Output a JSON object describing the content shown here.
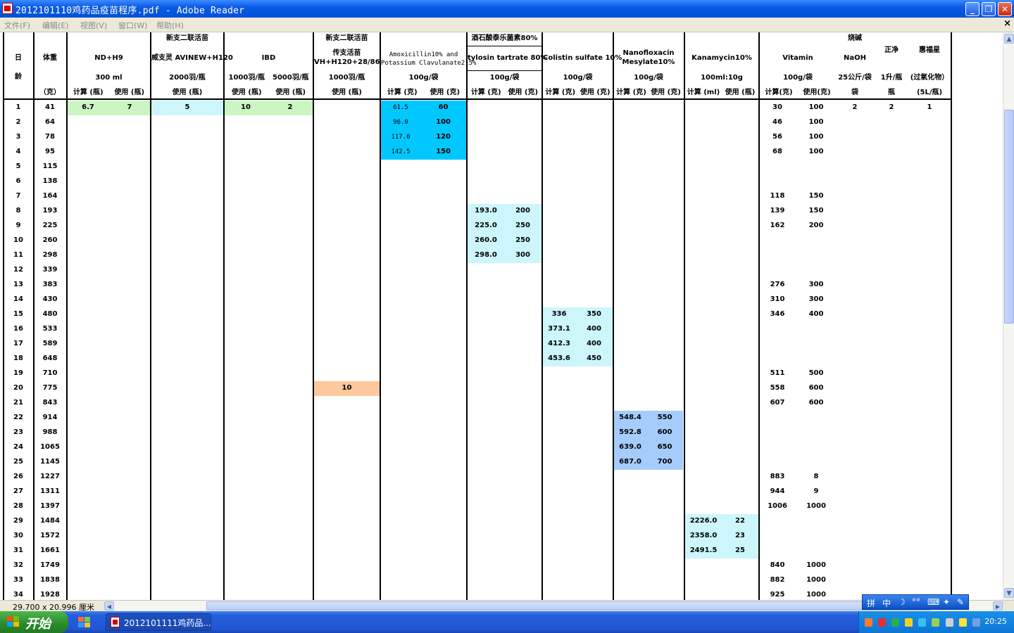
{
  "window": {
    "title": "2012101110鸡药品疫苗程序.pdf - Adobe Reader",
    "minimize": "_",
    "restore": "❐",
    "close": "✕"
  },
  "menu": {
    "items": [
      "文件(F)",
      "编辑(E)",
      "视图(V)",
      "窗口(W)",
      "帮助(H)"
    ],
    "doc_close": "×"
  },
  "table": {
    "header_day": [
      "日",
      "龄"
    ],
    "header_weight": [
      "体重",
      "（克）"
    ],
    "col_groups": [
      {
        "top": "",
        "name": "ND+H9",
        "unit": "300 ml",
        "subs": [
          "计算 (瓶)",
          "使用 (瓶)"
        ]
      },
      {
        "top": "新支二联活苗",
        "name": "威支灵 AVINEW+H120",
        "unit": "2000羽/瓶",
        "subs": [
          "使用 (瓶)"
        ]
      },
      {
        "top": "",
        "name": "IBD",
        "unit": "",
        "subs": [
          "1000羽/瓶",
          "5000羽/瓶"
        ],
        "subs2": [
          "使用 (瓶)",
          "使用 (瓶)"
        ]
      },
      {
        "top": "新支二联活苗",
        "name": "传支活苗 VH+H120+28/86",
        "unit": "1000羽/瓶",
        "subs": [
          "使用 (瓶)"
        ]
      },
      {
        "top": "",
        "name": "Amoxicillin10% and Potassium Clavulanate2.5%",
        "unit": "100g/袋",
        "subs": [
          "计算 (克)",
          "使用 (克)"
        ]
      },
      {
        "top": "酒石酸泰乐菌素80%",
        "name": "tylosin tartrate 80%",
        "unit": "100g/袋",
        "subs": [
          "计算 (克)",
          "使用 (克)"
        ]
      },
      {
        "top": "",
        "name": "Colistin sulfate 10%",
        "unit": "100g/袋",
        "subs": [
          "计算 (克)",
          "使用 (克)"
        ]
      },
      {
        "top": "",
        "name": "Nanofloxacin Mesylate10%",
        "unit": "100g/袋",
        "subs": [
          "计算 (克)",
          "使用 (克)"
        ]
      },
      {
        "top": "",
        "name": "Kanamycin10%",
        "unit": "100ml:10g",
        "subs": [
          "计算 (ml)",
          "使用 (瓶)"
        ]
      },
      {
        "top": "",
        "name": "Vitamin",
        "unit": "100g/袋",
        "subs": [
          "计算(克)",
          "使用(克)"
        ]
      },
      {
        "top": "烧碱",
        "name": "NaOH",
        "unit": "25公斤/袋",
        "subs": [
          "袋"
        ]
      },
      {
        "top": "",
        "name": "正净",
        "unit": "1升/瓶",
        "subs": [
          "瓶"
        ]
      },
      {
        "top": "",
        "name": "惠福星",
        "unit": "(过氧化物）",
        "subs": [
          "(5L/瓶)"
        ]
      }
    ],
    "days": [
      "1",
      "2",
      "3",
      "4",
      "5",
      "6",
      "7",
      "8",
      "9",
      "10",
      "11",
      "12",
      "13",
      "14",
      "15",
      "16",
      "17",
      "18",
      "19",
      "20",
      "21",
      "22",
      "23",
      "24",
      "25",
      "26",
      "27",
      "28",
      "29",
      "30",
      "31",
      "32",
      "33",
      "34"
    ],
    "weights": [
      "41",
      "64",
      "78",
      "95",
      "115",
      "138",
      "164",
      "193",
      "225",
      "260",
      "298",
      "339",
      "383",
      "430",
      "480",
      "533",
      "589",
      "648",
      "710",
      "775",
      "843",
      "914",
      "988",
      "1065",
      "1145",
      "1227",
      "1311",
      "1397",
      "1484",
      "1572",
      "1661",
      "1749",
      "1838",
      "1928"
    ],
    "nd_h9": {
      "calc": "6.7",
      "use": "7"
    },
    "avinew": "5",
    "ibd": {
      "a": "10",
      "b": "2"
    },
    "vh": "10",
    "amox": {
      "calc": [
        "61.5",
        "96.0",
        "117.0",
        "142.5"
      ],
      "use": [
        "60",
        "100",
        "120",
        "150"
      ]
    },
    "tylosin": {
      "calc": [
        "193.0",
        "225.0",
        "260.0",
        "298.0"
      ],
      "use": [
        "200",
        "250",
        "250",
        "300"
      ]
    },
    "colistin": {
      "calc": [
        "336",
        "373.1",
        "412.3",
        "453.6"
      ],
      "use": [
        "350",
        "400",
        "400",
        "450"
      ]
    },
    "nano": {
      "calc": [
        "548.4",
        "592.8",
        "639.0",
        "687.0"
      ],
      "use": [
        "550",
        "600",
        "650",
        "700"
      ]
    },
    "kana": {
      "calc": [
        "2226.0",
        "2358.0",
        "2491.5"
      ],
      "use": [
        "22",
        "23",
        "25"
      ]
    },
    "vitamin": [
      {
        "day": 1,
        "calc": "30",
        "use": "100"
      },
      {
        "day": 2,
        "calc": "46",
        "use": "100"
      },
      {
        "day": 3,
        "calc": "56",
        "use": "100"
      },
      {
        "day": 4,
        "calc": "68",
        "use": "100"
      },
      {
        "day": 7,
        "calc": "118",
        "use": "150"
      },
      {
        "day": 8,
        "calc": "139",
        "use": "150"
      },
      {
        "day": 9,
        "calc": "162",
        "use": "200"
      },
      {
        "day": 13,
        "calc": "276",
        "use": "300"
      },
      {
        "day": 14,
        "calc": "310",
        "use": "300"
      },
      {
        "day": 15,
        "calc": "346",
        "use": "400"
      },
      {
        "day": 19,
        "calc": "511",
        "use": "500"
      },
      {
        "day": 20,
        "calc": "558",
        "use": "600"
      },
      {
        "day": 21,
        "calc": "607",
        "use": "600"
      },
      {
        "day": 26,
        "calc": "883",
        "use": "8"
      },
      {
        "day": 27,
        "calc": "944",
        "use": "9"
      },
      {
        "day": 28,
        "calc": "1006",
        "use": "1000"
      },
      {
        "day": 32,
        "calc": "840",
        "use": "1000"
      },
      {
        "day": 33,
        "calc": "882",
        "use": "1000"
      },
      {
        "day": 34,
        "calc": "925",
        "use": "1000"
      }
    ],
    "naoh": "2",
    "zhengjing": "2",
    "huifuxing": "1",
    "colors": {
      "green": "#ccf5c4",
      "lightcyan": "#ccf6fc",
      "cyan": "#00c8ff",
      "orange": "#fcc89c",
      "blue": "#a4ccfc"
    }
  },
  "status": {
    "page_size": "29.700 x 20.996 厘米"
  },
  "ime": {
    "labels": [
      "拼",
      "中",
      "☽",
      "°°",
      "⌨",
      "✦",
      "✎"
    ]
  },
  "taskbar": {
    "start": "开始",
    "task": "2012101111鸡药品...",
    "clock": "20:25"
  }
}
